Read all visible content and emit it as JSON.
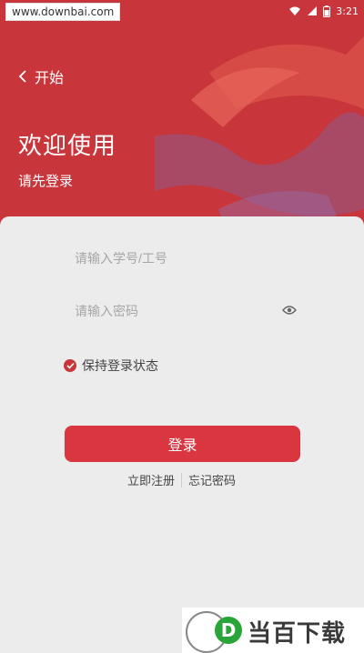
{
  "status_bar": {
    "watermark": "www.downbai.com",
    "time": "3:21",
    "icons": [
      "wifi-icon",
      "signal-icon",
      "battery-icon"
    ]
  },
  "header": {
    "back_label": "开始",
    "welcome": "欢迎使用",
    "subtitle": "请先登录"
  },
  "form": {
    "id_placeholder": "请输入学号/工号",
    "password_placeholder": "请输入密码",
    "remember_label": "保持登录状态",
    "remember_checked": true,
    "login_label": "登录",
    "register_link": "立即注册",
    "forgot_link": "忘记密码"
  },
  "logo": {
    "letter": "D",
    "text": "当百下载"
  },
  "colors": {
    "primary": "#d9363f",
    "header_bg": "#c8353b",
    "card_bg": "#ececec"
  }
}
